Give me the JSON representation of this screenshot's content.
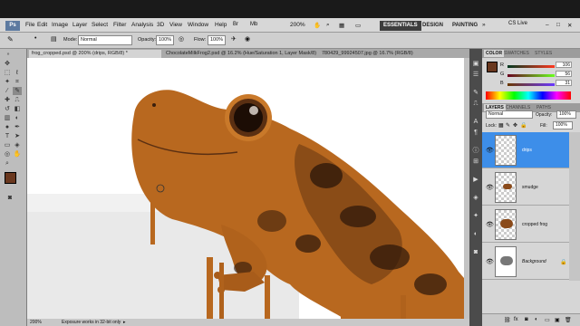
{
  "menubar": {
    "logo": "Ps",
    "items": [
      "File",
      "Edit",
      "Image",
      "Layer",
      "Select",
      "Filter",
      "Analysis",
      "3D",
      "View",
      "Window",
      "Help"
    ],
    "zoom": "200%",
    "workspaces": [
      "ESSENTIALS",
      "DESIGN",
      "PAINTING"
    ],
    "cslive": "CS Live"
  },
  "options": {
    "mode_label": "Mode:",
    "mode_value": "Normal",
    "opacity_label": "Opacity:",
    "opacity_value": "100%",
    "flow_label": "Flow:",
    "flow_value": "100%"
  },
  "tabs": [
    "frog_cropped.psd @ 200% (drips, RGB/8) *",
    "ChocolateMilkFrog2.psd @ 16.2% (Hue/Saturation 1, Layer Mask/8)",
    "780429_99924507.jpg @ 16.7% (RGB/8)"
  ],
  "status": {
    "zoom": "200%",
    "message": "Exposure works in 32-bit only"
  },
  "color_panel": {
    "tabs": [
      "COLOR",
      "SWATCHES",
      "STYLES"
    ],
    "channels": [
      {
        "label": "R",
        "value": "106"
      },
      {
        "label": "G",
        "value": "56"
      },
      {
        "label": "B",
        "value": "31"
      }
    ],
    "fg_color": "#6a381f"
  },
  "layers_panel": {
    "tabs": [
      "LAYERS",
      "CHANNELS",
      "PATHS"
    ],
    "blend_mode": "Normal",
    "opacity_label": "Opacity:",
    "opacity_value": "100%",
    "lock_label": "Lock:",
    "fill_label": "Fill:",
    "fill_value": "100%",
    "layers": [
      {
        "name": "drips",
        "selected": true
      },
      {
        "name": "smudge",
        "selected": false
      },
      {
        "name": "cropped frog",
        "selected": false
      },
      {
        "name": "Background",
        "selected": false
      }
    ]
  },
  "colors": {
    "frog_orange": "#b8681f",
    "selection_blue": "#3d8ee9",
    "active_workspace": "#3d3d3d"
  }
}
